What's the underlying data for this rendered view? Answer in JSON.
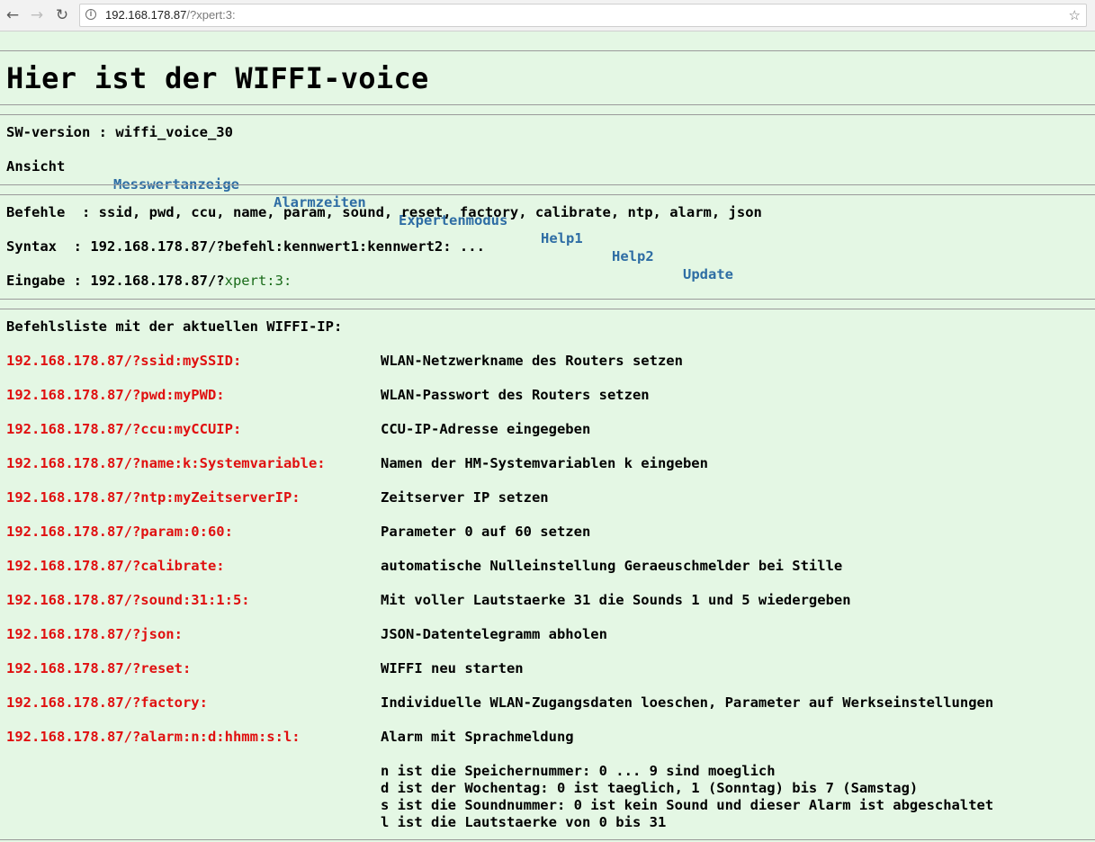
{
  "browser": {
    "url_host": "192.168.178.87",
    "url_rest": "/?xpert:3:"
  },
  "page": {
    "title": "Hier ist der WIFFI-voice",
    "sw_version_label": "SW-version : wiffi_voice_30",
    "ansicht_label": "Ansicht",
    "nav": [
      "Messwertanzeige",
      "Alarmzeiten",
      "Expertenmodus",
      "Help1",
      "Help2",
      "Update"
    ],
    "befehle_line": "Befehle  : ssid, pwd, ccu, name, param, sound, reset, factory, calibrate, ntp, alarm, json",
    "syntax_line": "Syntax  : 192.168.178.87/?befehl:kennwert1:kennwert2: ...",
    "eingabe_prefix": "Eingabe : 192.168.178.87/?",
    "eingabe_value": "xpert:3:",
    "befehlsliste_heading": "Befehlsliste mit der aktuellen WIFFI-IP:",
    "commands": [
      {
        "cmd": "192.168.178.87/?ssid:mySSID:",
        "desc": "WLAN-Netzwerkname des Routers setzen"
      },
      {
        "cmd": "192.168.178.87/?pwd:myPWD:",
        "desc": "WLAN-Passwort des Routers setzen"
      },
      {
        "cmd": "192.168.178.87/?ccu:myCCUIP:",
        "desc": "CCU-IP-Adresse eingegeben"
      },
      {
        "cmd": "192.168.178.87/?name:k:Systemvariable:",
        "desc": "Namen der HM-Systemvariablen k eingeben"
      },
      {
        "cmd": "192.168.178.87/?ntp:myZeitserverIP:",
        "desc": "Zeitserver IP setzen"
      },
      {
        "cmd": "192.168.178.87/?param:0:60:",
        "desc": "Parameter 0 auf 60 setzen"
      },
      {
        "cmd": "192.168.178.87/?calibrate:",
        "desc": "automatische Nulleinstellung Geraeuschmelder bei Stille"
      },
      {
        "cmd": "192.168.178.87/?sound:31:1:5:",
        "desc": "Mit voller Lautstaerke 31 die Sounds 1 und 5 wiedergeben"
      },
      {
        "cmd": "192.168.178.87/?json:",
        "desc": "JSON-Datentelegramm abholen"
      },
      {
        "cmd": "192.168.178.87/?reset:",
        "desc": "WIFFI neu starten"
      },
      {
        "cmd": "192.168.178.87/?factory:",
        "desc": "Individuelle WLAN-Zugangsdaten loeschen, Parameter auf Werkseinstellungen"
      },
      {
        "cmd": "192.168.178.87/?alarm:n:d:hhmm:s:l:",
        "desc": "Alarm mit Sprachmeldung"
      }
    ],
    "alarm_details": [
      "n ist die Speichernummer: 0 ... 9 sind moeglich",
      "d ist der Wochentag: 0 ist taeglich, 1 (Sonntag) bis 7 (Samstag)",
      "s ist die Soundnummer: 0 ist kein Sound und dieser Alarm ist abgeschaltet",
      "l ist die Lautstaerke von 0 bis 31"
    ]
  }
}
